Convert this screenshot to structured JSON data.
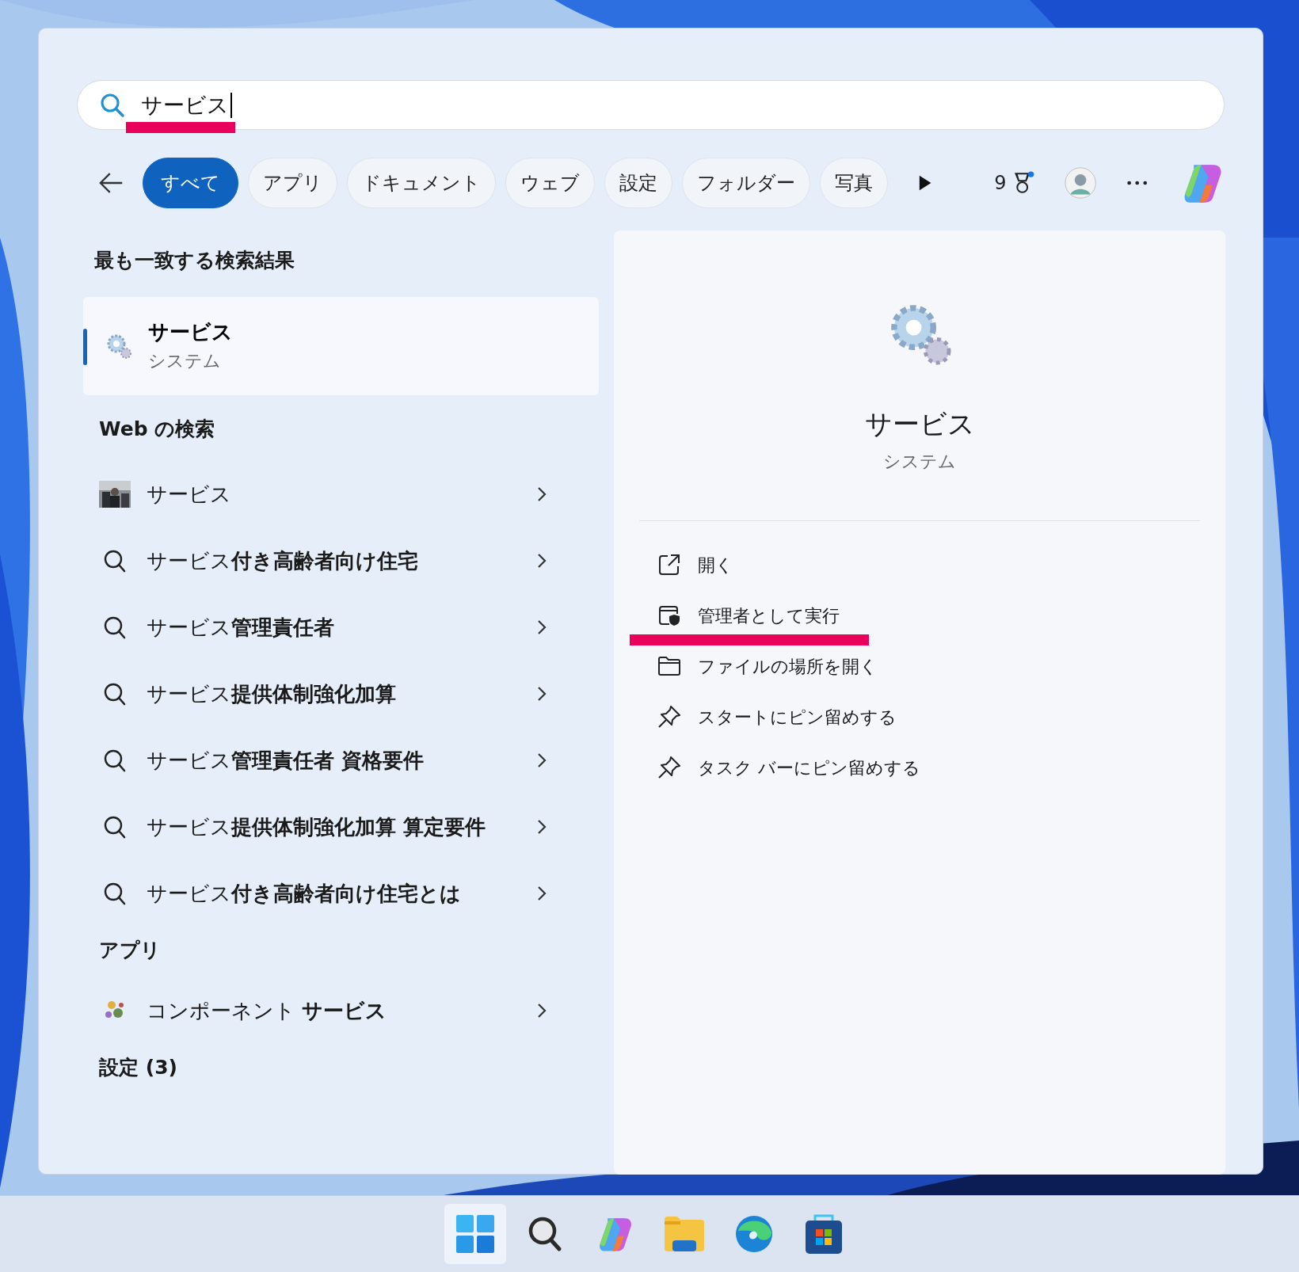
{
  "search": {
    "value": "サービス",
    "underlined": true
  },
  "filters": [
    {
      "label": "すべて",
      "selected": true
    },
    {
      "label": "アプリ",
      "selected": false
    },
    {
      "label": "ドキュメント",
      "selected": false
    },
    {
      "label": "ウェブ",
      "selected": false
    },
    {
      "label": "設定",
      "selected": false
    },
    {
      "label": "フォルダー",
      "selected": false
    },
    {
      "label": "写真",
      "selected": false
    }
  ],
  "rewards_count": "9",
  "best_match": {
    "heading": "最も一致する検索結果",
    "title": "サービス",
    "subtitle": "システム",
    "selected": true
  },
  "web": {
    "heading": "Web の検索",
    "items": [
      {
        "kind": "picture",
        "text": "サービス"
      },
      {
        "kind": "search",
        "text": "サービス**付き高齢者向け住宅**"
      },
      {
        "kind": "search",
        "text": "サービス**管理責任者**"
      },
      {
        "kind": "search",
        "text": "サービス**提供体制強化加算**"
      },
      {
        "kind": "search",
        "text": "サービス**管理責任者 資格要件**"
      },
      {
        "kind": "search",
        "text": "サービス**提供体制強化加算 算定要件**"
      },
      {
        "kind": "search",
        "text": "サービス**付き高齢者向け住宅とは**"
      }
    ]
  },
  "apps": {
    "heading": "アプリ",
    "items": [
      {
        "text": "コンポーネント **サービス**"
      }
    ]
  },
  "settings": {
    "heading": "設定 (3)"
  },
  "detail": {
    "title": "サービス",
    "subtitle": "システム",
    "actions": [
      {
        "kind": "open",
        "label": "開く",
        "underlined": false
      },
      {
        "kind": "admin",
        "label": "管理者として実行",
        "underlined": true
      },
      {
        "kind": "folder",
        "label": "ファイルの場所を開く",
        "underlined": false
      },
      {
        "kind": "pin",
        "label": "スタートにピン留めする",
        "underlined": false
      },
      {
        "kind": "pin",
        "label": "タスク バーにピン留めする",
        "underlined": false
      }
    ]
  }
}
